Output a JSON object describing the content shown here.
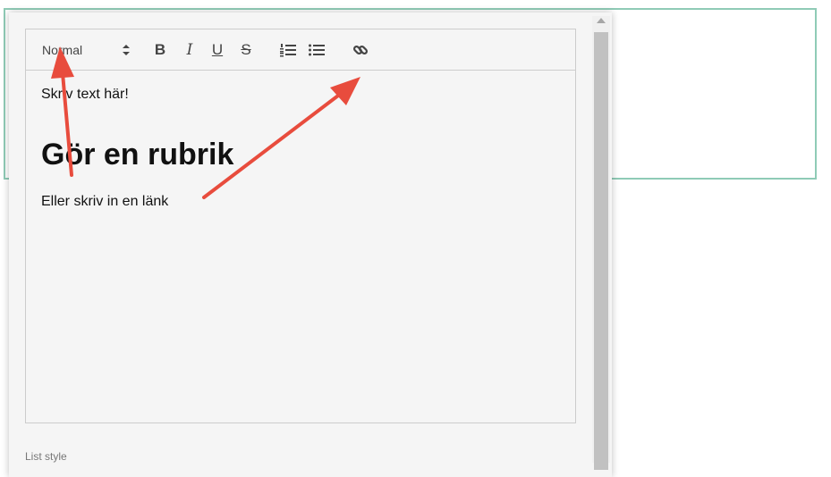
{
  "editor": {
    "toolbar": {
      "format_value": "Normal",
      "bold_glyph": "B",
      "italic_glyph": "I",
      "underline_glyph": "U",
      "strike_glyph": "S"
    },
    "content": {
      "paragraph1": "Skriv text här!",
      "heading": "Gör en rubrik",
      "paragraph2": "Eller skriv in en länk"
    }
  },
  "list_style_label": "List style",
  "colors": {
    "frame_border": "#8fcbb6",
    "annotation_arrow": "#e84c3d",
    "panel_bg": "#f5f5f5"
  }
}
